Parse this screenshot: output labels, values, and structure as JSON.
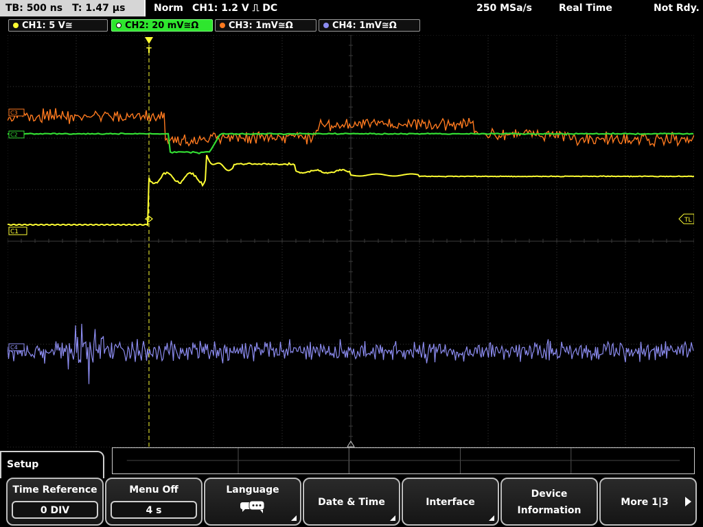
{
  "status_bar": {
    "timebase": "TB: 500 ns",
    "trigger_time": "T: 1.47 µs",
    "trigger_mode": "Norm",
    "trigger_info": "CH1: 1.2 V ⎍ DC",
    "sample_rate": "250 MSa/s",
    "acq_mode": "Real Time",
    "readiness": "Not Rdy."
  },
  "channels": [
    {
      "label": "CH1: 5 V≅",
      "color": "#ffff33",
      "active": false
    },
    {
      "label": "CH2: 20 mV≅Ω",
      "color": "#33dd33",
      "active": true
    },
    {
      "label": "CH3: 1mV≅Ω",
      "color": "#ff7a1f",
      "active": false
    },
    {
      "label": "CH4: 1mV≅Ω",
      "color": "#8c8cf0",
      "active": false
    }
  ],
  "display": {
    "markers": {
      "c1": "C1",
      "c2": "C2",
      "c3": "C3",
      "c4": "C4",
      "trigger_level": "TL",
      "trigger_pos": "T"
    },
    "grid_color": "#3a3a3a"
  },
  "menu": {
    "title": "Setup",
    "time_reference_label": "Time Reference",
    "time_reference_value": "0 DIV",
    "menu_off_label": "Menu Off",
    "menu_off_value": "4 s",
    "language_label": "Language",
    "date_time_label": "Date & Time",
    "interface_label": "Interface",
    "device_info_line1": "Device",
    "device_info_line2": "Information",
    "more_label": "More 1|3"
  }
}
